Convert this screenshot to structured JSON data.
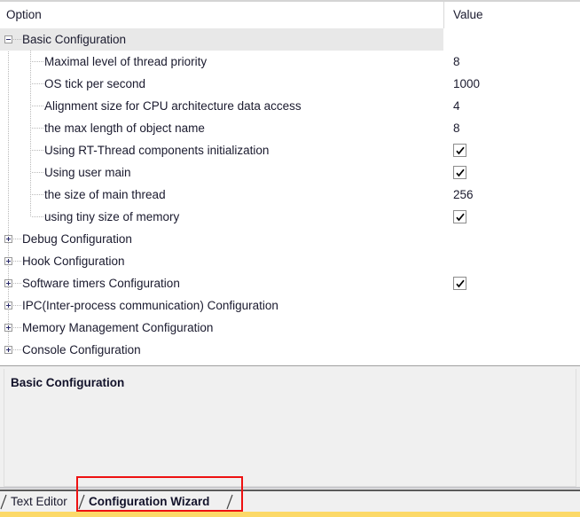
{
  "columns": {
    "option_header": "Option",
    "value_header": "Value"
  },
  "tree": {
    "rows": [
      {
        "label": "Basic Configuration",
        "level": 0,
        "expander": "minus",
        "selected": true,
        "value": "",
        "value_type": "none"
      },
      {
        "label": "Maximal level of thread priority",
        "level": 1,
        "expander": "none",
        "selected": false,
        "value": "8",
        "value_type": "text"
      },
      {
        "label": "OS tick per second",
        "level": 1,
        "expander": "none",
        "selected": false,
        "value": "1000",
        "value_type": "text"
      },
      {
        "label": "Alignment size for CPU architecture data access",
        "level": 1,
        "expander": "none",
        "selected": false,
        "value": "4",
        "value_type": "text"
      },
      {
        "label": "the max length of object name",
        "level": 1,
        "expander": "none",
        "selected": false,
        "value": "8",
        "value_type": "text"
      },
      {
        "label": "Using RT-Thread components initialization",
        "level": 1,
        "expander": "none",
        "selected": false,
        "value": "checked",
        "value_type": "checkbox"
      },
      {
        "label": "Using user main",
        "level": 1,
        "expander": "none",
        "selected": false,
        "value": "checked",
        "value_type": "checkbox"
      },
      {
        "label": "the size of main thread",
        "level": 1,
        "expander": "none",
        "selected": false,
        "value": "256",
        "value_type": "text"
      },
      {
        "label": "using tiny size of memory",
        "level": 1,
        "expander": "none",
        "selected": false,
        "value": "checked",
        "value_type": "checkbox"
      },
      {
        "label": "Debug Configuration",
        "level": 0,
        "expander": "plus",
        "selected": false,
        "value": "",
        "value_type": "none"
      },
      {
        "label": "Hook Configuration",
        "level": 0,
        "expander": "plus",
        "selected": false,
        "value": "",
        "value_type": "none"
      },
      {
        "label": "Software timers Configuration",
        "level": 0,
        "expander": "plus",
        "selected": false,
        "value": "checked",
        "value_type": "checkbox"
      },
      {
        "label": "IPC(Inter-process communication) Configuration",
        "level": 0,
        "expander": "plus",
        "selected": false,
        "value": "",
        "value_type": "none"
      },
      {
        "label": "Memory Management Configuration",
        "level": 0,
        "expander": "plus",
        "selected": false,
        "value": "",
        "value_type": "none"
      },
      {
        "label": "Console Configuration",
        "level": 0,
        "expander": "plus",
        "selected": false,
        "value": "",
        "value_type": "none"
      }
    ]
  },
  "description": {
    "title": "Basic Configuration"
  },
  "tabs": [
    {
      "label": "Text Editor",
      "active": false
    },
    {
      "label": "Configuration Wizard",
      "active": true
    }
  ],
  "annotation": {
    "color": "#ee1111"
  }
}
